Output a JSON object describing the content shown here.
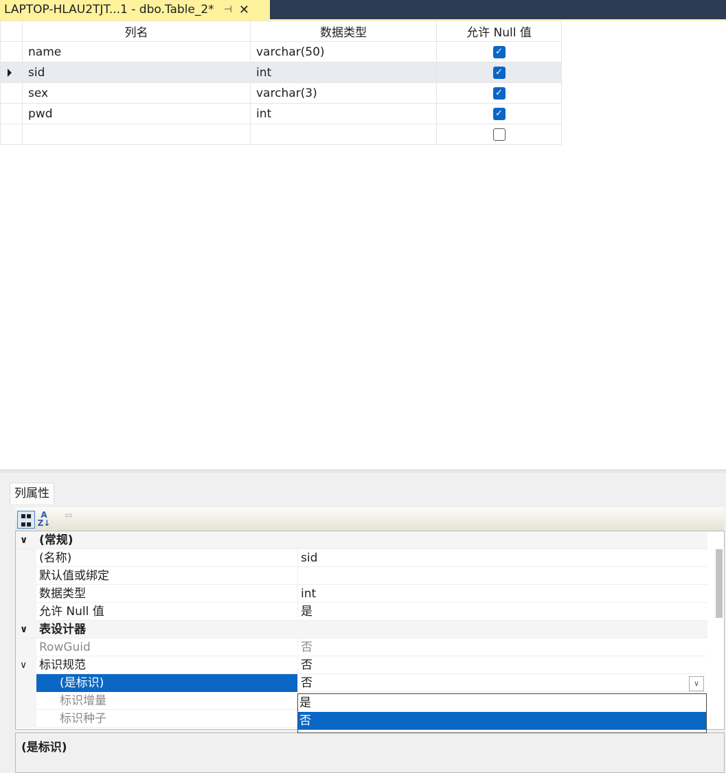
{
  "tab": {
    "title": "LAPTOP-HLAU2TJT...1 - dbo.Table_2*",
    "pin_icon": "pin-icon",
    "close_icon": "close-icon"
  },
  "grid": {
    "headers": [
      "列名",
      "数据类型",
      "允许 Null 值"
    ],
    "rows": [
      {
        "name": "name",
        "type": "varchar(50)",
        "allow_null": true
      },
      {
        "name": "sid",
        "type": "int",
        "allow_null": true
      },
      {
        "name": "sex",
        "type": "varchar(3)",
        "allow_null": true
      },
      {
        "name": "pwd",
        "type": "int",
        "allow_null": true
      },
      {
        "name": "",
        "type": "",
        "allow_null": false
      }
    ],
    "current_row": 1
  },
  "properties_panel": {
    "tab_label": "列属性",
    "toolbar_icons": [
      "categorized-icon",
      "alphabetical-sort-icon",
      "property-pages-icon"
    ],
    "sections": {
      "general": "(常规)",
      "designer": "表设计器"
    },
    "rows": {
      "name_key": "(名称)",
      "name_val": "sid",
      "default_key": "默认值或绑定",
      "default_val": "",
      "type_key": "数据类型",
      "type_val": "int",
      "null_key": "允许 Null 值",
      "null_val": "是",
      "rowguid_key": "RowGuid",
      "rowguid_val": "否",
      "identity_spec_key": "标识规范",
      "identity_spec_val": "否",
      "is_identity_key": "(是标识)",
      "is_identity_val": "否",
      "increment_key": "标识增量",
      "seed_key": "标识种子"
    },
    "dropdown_options": [
      "是",
      "否"
    ],
    "dropdown_selected": "否",
    "description": "(是标识)"
  },
  "colors": {
    "accent_tab": "#fff29d",
    "selection": "#0b67c5",
    "titlebar": "#2d3b55"
  }
}
